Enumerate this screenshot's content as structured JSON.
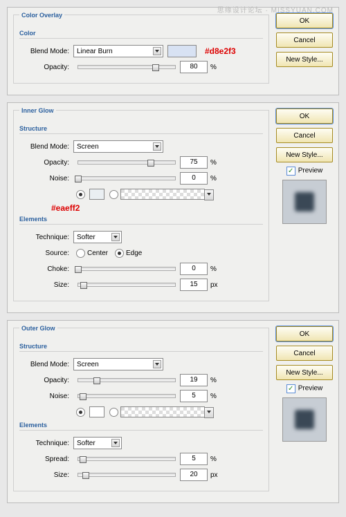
{
  "watermark": "思缘设计论坛 · MISSYUAN.COM",
  "buttons": {
    "ok": "OK",
    "cancel": "Cancel",
    "newstyle": "New Style...",
    "preview": "Preview"
  },
  "labels": {
    "blend": "Blend Mode:",
    "opacity": "Opacity:",
    "noise": "Noise:",
    "technique": "Technique:",
    "source": "Source:",
    "center": "Center",
    "edge": "Edge",
    "choke": "Choke:",
    "size": "Size:",
    "spread": "Spread:"
  },
  "sections": {
    "color": "Color",
    "structure": "Structure",
    "elements": "Elements"
  },
  "panel1": {
    "title": "Color Overlay",
    "blend": "Linear Burn",
    "swatch": "#d8e2f3",
    "opacity": "80",
    "annot": "#d8e2f3"
  },
  "panel2": {
    "title": "Inner Glow",
    "blend": "Screen",
    "opacity": "75",
    "noise": "0",
    "annot": "#eaeff2",
    "technique": "Softer",
    "choke": "0",
    "size": "15"
  },
  "panel3": {
    "title": "Outer Glow",
    "blend": "Screen",
    "opacity": "19",
    "noise": "5",
    "technique": "Softer",
    "spread": "5",
    "size": "20"
  },
  "units": {
    "pct": "%",
    "px": "px"
  }
}
